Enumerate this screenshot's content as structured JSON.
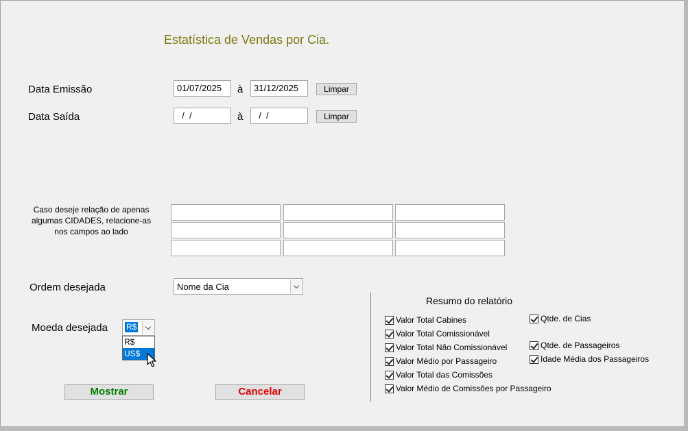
{
  "title": "Estatística de Vendas por Cia.",
  "data_emissao": {
    "label": "Data Emissão",
    "from": "01/07/2025",
    "sep": "à",
    "to": "31/12/2025",
    "clear_label": "Limpar"
  },
  "data_saida": {
    "label": "Data Saída",
    "from": "  /  /",
    "sep": "à",
    "to": "  /  /",
    "clear_label": "Limpar"
  },
  "cidades": {
    "label_lines": [
      "Caso deseje relação de apenas",
      "algumas CIDADES, relacione-as",
      "nos campos ao lado"
    ],
    "fields": [
      "",
      "",
      "",
      "",
      "",
      "",
      "",
      "",
      ""
    ]
  },
  "ordem": {
    "label": "Ordem desejada",
    "selected": "Nome da Cia"
  },
  "moeda": {
    "label": "Moeda desejada",
    "selected": "R$",
    "options": [
      "R$",
      "US$"
    ],
    "highlighted": "US$"
  },
  "buttons": {
    "mostrar": "Mostrar",
    "cancelar": "Cancelar",
    "mostrar_color": "#008000",
    "cancelar_color": "#e00000"
  },
  "resumo": {
    "title": "Resumo do relatório",
    "left": [
      {
        "label": "Valor Total Cabines",
        "checked": true
      },
      {
        "label": "Valor Total Comissionável",
        "checked": true
      },
      {
        "label": "Valor Total Não Comissionável",
        "checked": true
      },
      {
        "label": "Valor Médio por Passageiro",
        "checked": true
      },
      {
        "label": "Valor Total das Comissões",
        "checked": true
      },
      {
        "label": "Valor Médio de Comissões por Passageiro",
        "checked": true
      }
    ],
    "right": [
      {
        "label": "Qtde. de Cias",
        "checked": true
      },
      {
        "label": "Qtde. de Passageiros",
        "checked": true
      },
      {
        "label": "Idade Média dos Passageiros",
        "checked": true
      }
    ]
  },
  "title_color": "#7a7a10"
}
